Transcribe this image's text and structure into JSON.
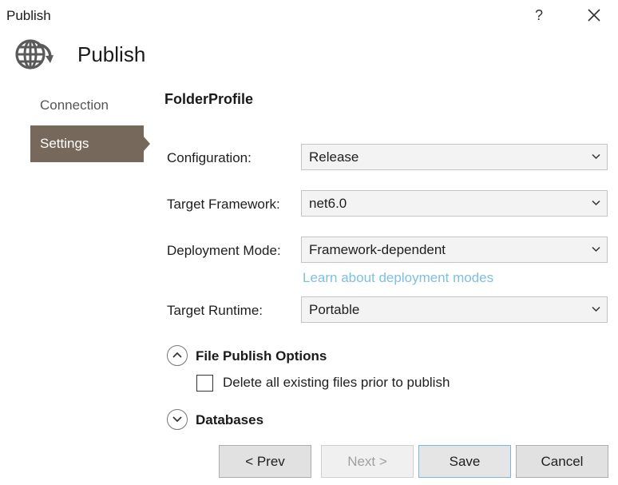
{
  "window": {
    "title": "Publish",
    "help_label": "?",
    "close_icon": "close-icon"
  },
  "header": {
    "icon": "globe-publish-icon",
    "title": "Publish"
  },
  "nav": {
    "items": [
      {
        "label": "Connection",
        "selected": false
      },
      {
        "label": "Settings",
        "selected": true
      }
    ],
    "selected_color": "#76695c"
  },
  "main": {
    "profile_name": "FolderProfile",
    "fields": [
      {
        "label": "Configuration:",
        "value": "Release"
      },
      {
        "label": "Target Framework:",
        "value": "net6.0"
      },
      {
        "label": "Deployment Mode:",
        "value": "Framework-dependent"
      },
      {
        "label": "Target Runtime:",
        "value": "Portable"
      }
    ],
    "deployment_link": "Learn about deployment modes",
    "link_color": "#7fbfe0",
    "file_publish_options": {
      "title": "File Publish Options",
      "expanded": true,
      "delete_existing": {
        "label": "Delete all existing files prior to publish",
        "checked": false
      }
    },
    "databases": {
      "title": "Databases",
      "expanded": false
    }
  },
  "buttons": {
    "prev": "< Prev",
    "next": "Next >",
    "save": "Save",
    "cancel": "Cancel"
  }
}
